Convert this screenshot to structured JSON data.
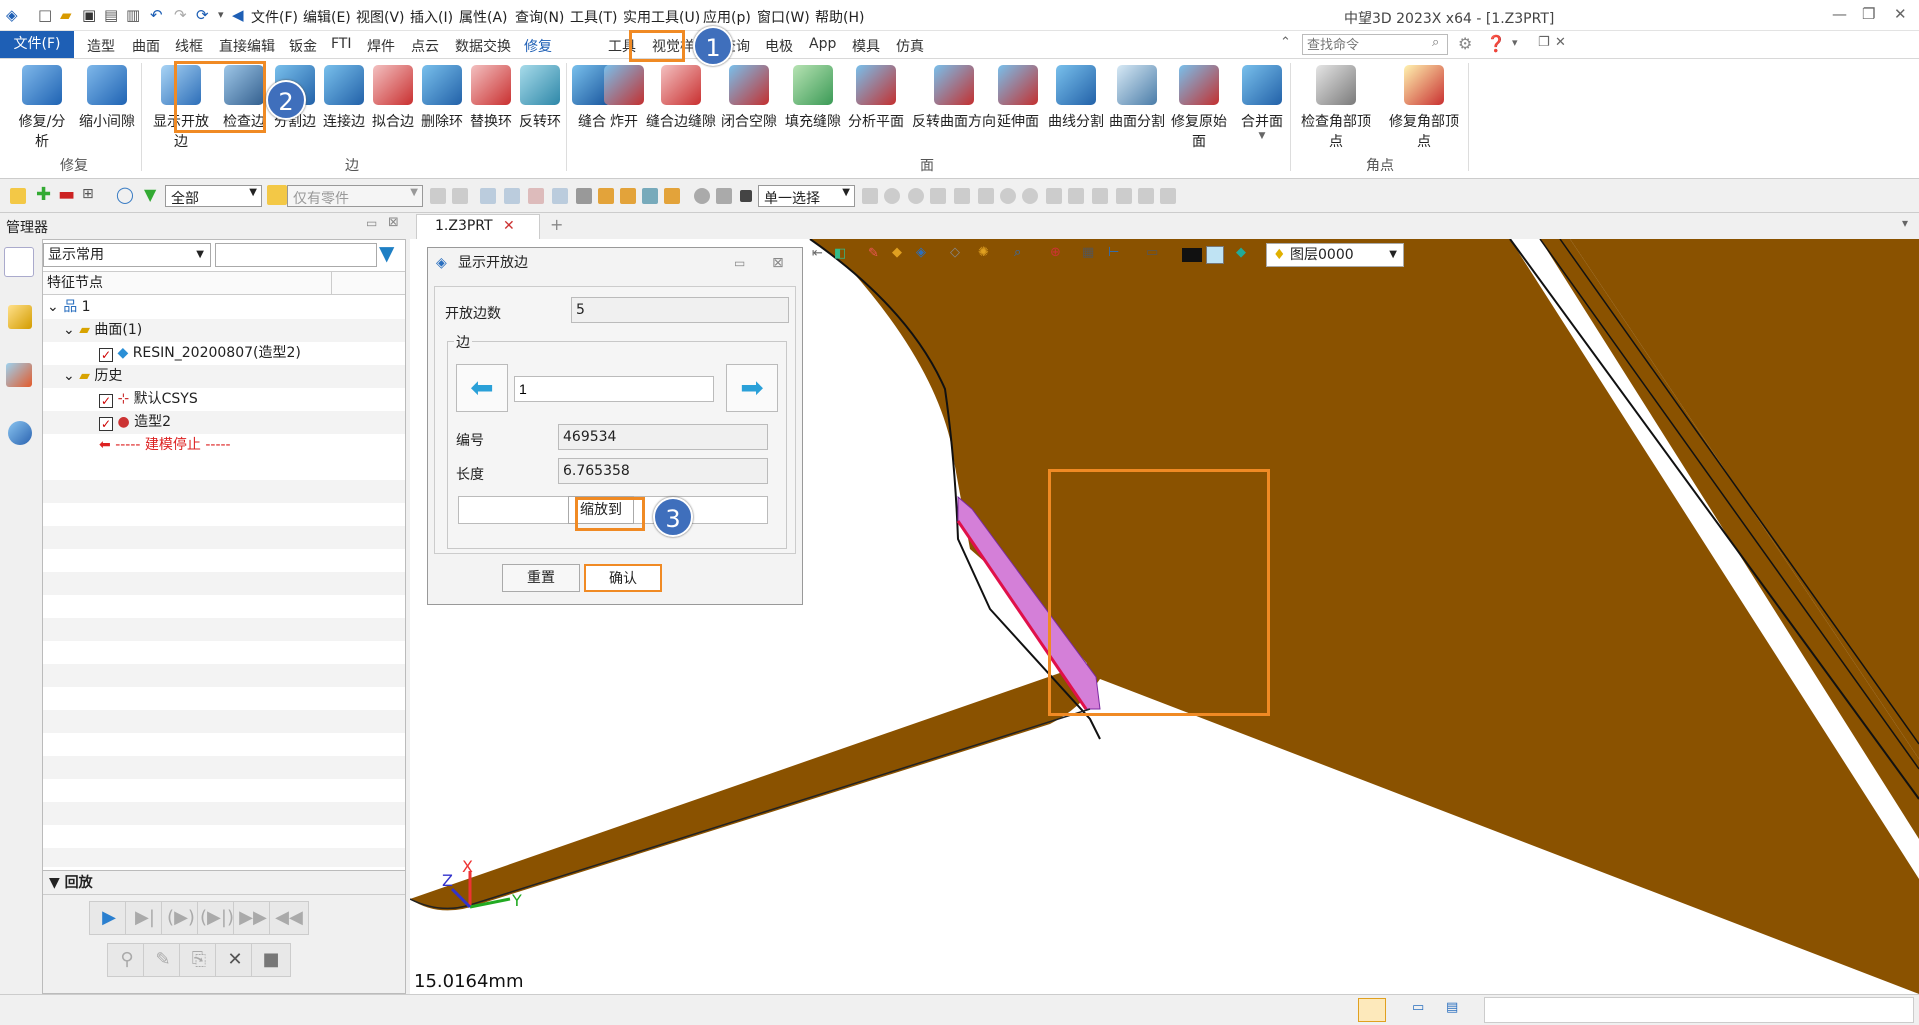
{
  "window_title": "中望3D 2023X x64 - [1.Z3PRT]",
  "menus": [
    "文件(F)",
    "编辑(E)",
    "视图(V)",
    "插入(I)",
    "属性(A)",
    "查询(N)",
    "工具(T)",
    "实用工具(U)",
    "应用(p)",
    "窗口(W)",
    "帮助(H)"
  ],
  "ribbon_tabs": [
    "文件(F)",
    "造型",
    "曲面",
    "线框",
    "直接编辑",
    "钣金",
    "FTI",
    "焊件",
    "点云",
    "数据交换",
    "修复",
    "工具",
    "视觉样式",
    "查询",
    "电极",
    "App",
    "模具",
    "仿真"
  ],
  "search_placeholder": "查找命令",
  "ribbon": {
    "group1": {
      "label": "修复",
      "buttons": [
        "修复/分析",
        "缩小间隙"
      ]
    },
    "group2": {
      "label": "边",
      "buttons": [
        "显示开放边",
        "检查边",
        "分割边",
        "连接边",
        "拟合边",
        "删除环",
        "替换环",
        "反转环"
      ]
    },
    "group3": {
      "label": "面",
      "buttons": [
        "缝合",
        "炸开",
        "缝合边缝隙",
        "闭合空隙",
        "填充缝隙",
        "分析平面",
        "反转曲面方向",
        "延伸面",
        "曲线分割",
        "曲面分割",
        "修复原始面",
        "合并面"
      ]
    },
    "group4": {
      "label": "角点",
      "buttons": [
        "检查角部顶点",
        "修复角部顶点"
      ]
    }
  },
  "toolbar2": {
    "filter_value": "全部",
    "part_filter": "仅有零件",
    "select_mode": "单一选择"
  },
  "manager": {
    "title": "管理器",
    "filter_value": "显示常用",
    "column_header": "特征节点",
    "tree": [
      {
        "label": "1"
      },
      {
        "label": "曲面(1)"
      },
      {
        "label": "RESIN_20200807(造型2)"
      },
      {
        "label": "历史"
      },
      {
        "label": "默认CSYS"
      },
      {
        "label": "造型2"
      },
      {
        "label": "----- 建模停止 -----"
      }
    ],
    "replay_label": "回放"
  },
  "doc_tab": "1.Z3PRT",
  "view_toolbar": {
    "layer": "图层0000"
  },
  "dialog": {
    "title": "显示开放边",
    "open_edges_label": "开放边数",
    "open_edges_value": "5",
    "edge_group_label": "边",
    "edge_index_value": "1",
    "id_label": "编号",
    "id_value": "469534",
    "length_label": "长度",
    "length_value": "6.765358",
    "zoom_button": "缩放到",
    "reset_button": "重置",
    "ok_button": "确认"
  },
  "badges": [
    "1",
    "2",
    "3"
  ],
  "scale_readout": "15.0164mm",
  "axes": {
    "z": "Z",
    "x": "X",
    "y": "Y"
  },
  "colors": {
    "accent": "#1e5fb5",
    "highlight": "#f08a24",
    "part": "#8a5200",
    "face_highlight": "#d47fd8",
    "badge": "#3f6fbc"
  }
}
